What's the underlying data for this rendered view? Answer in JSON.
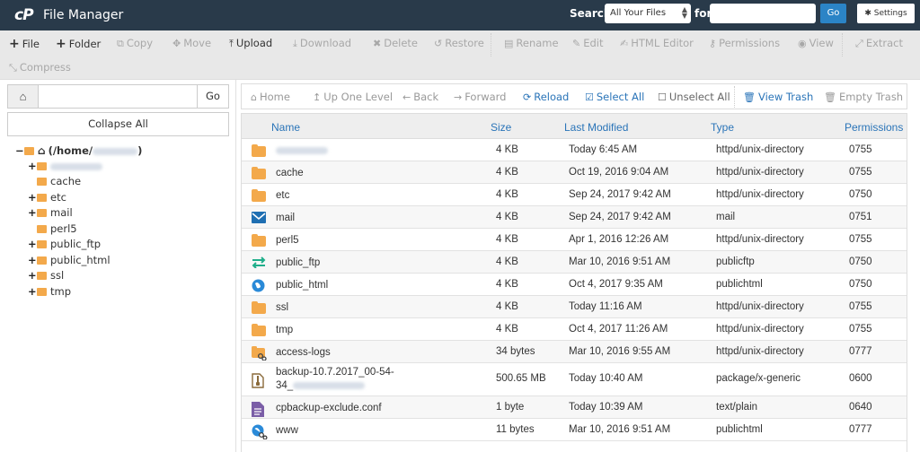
{
  "app": {
    "logo": "cP",
    "title": "File Manager"
  },
  "search": {
    "label": "Search",
    "scope_selected": "All Your Files",
    "for_label": "for",
    "query_value": "",
    "go_label": "Go"
  },
  "settings_label": "Settings",
  "toolbar": {
    "items": [
      {
        "label": "File",
        "icon": "plus-icon",
        "enabled": true
      },
      {
        "label": "Folder",
        "icon": "plus-icon",
        "enabled": true
      },
      {
        "label": "Copy",
        "icon": "copy-icon",
        "enabled": false
      },
      {
        "label": "Move",
        "icon": "move-icon",
        "enabled": false
      },
      {
        "label": "Upload",
        "icon": "upload-icon",
        "enabled": true
      },
      {
        "label": "Download",
        "icon": "download-icon",
        "enabled": false
      },
      {
        "label": "Delete",
        "icon": "delete-icon",
        "enabled": false
      },
      {
        "label": "Restore",
        "icon": "restore-icon",
        "enabled": false
      },
      {
        "label": "Rename",
        "icon": "file-icon",
        "enabled": false
      },
      {
        "label": "Edit",
        "icon": "pencil-icon",
        "enabled": false
      },
      {
        "label": "HTML Editor",
        "icon": "edit-square-icon",
        "enabled": false
      },
      {
        "label": "Permissions",
        "icon": "key-icon",
        "enabled": false
      },
      {
        "label": "View",
        "icon": "eye-icon",
        "enabled": false
      },
      {
        "label": "Extract",
        "icon": "expand-icon",
        "enabled": false
      },
      {
        "label": "Compress",
        "icon": "compress-icon",
        "enabled": false
      }
    ]
  },
  "left": {
    "path_value": "",
    "go_label": "Go",
    "collapse_label": "Collapse All",
    "tree": {
      "root_label": "(/home/",
      "items": [
        {
          "label": "",
          "blurred": true,
          "expandable": true
        },
        {
          "label": "cache",
          "expandable": false
        },
        {
          "label": "etc",
          "expandable": true
        },
        {
          "label": "mail",
          "expandable": true
        },
        {
          "label": "perl5",
          "expandable": false
        },
        {
          "label": "public_ftp",
          "expandable": true
        },
        {
          "label": "public_html",
          "expandable": true
        },
        {
          "label": "ssl",
          "expandable": true
        },
        {
          "label": "tmp",
          "expandable": true
        }
      ]
    }
  },
  "nav": {
    "home": "Home",
    "up": "Up One Level",
    "back": "Back",
    "forward": "Forward",
    "reload": "Reload",
    "select_all": "Select All",
    "unselect_all": "Unselect All",
    "view_trash": "View Trash",
    "empty_trash": "Empty Trash"
  },
  "table": {
    "headers": {
      "name": "Name",
      "size": "Size",
      "modified": "Last Modified",
      "type": "Type",
      "permissions": "Permissions"
    },
    "rows": [
      {
        "icon": "folder-icon",
        "name": "",
        "blurred": true,
        "size": "4 KB",
        "modified": "Today 6:45 AM",
        "type": "httpd/unix-directory",
        "perms": "0755"
      },
      {
        "icon": "folder-icon",
        "name": "cache",
        "size": "4 KB",
        "modified": "Oct 19, 2016 9:04 AM",
        "type": "httpd/unix-directory",
        "perms": "0755"
      },
      {
        "icon": "folder-icon",
        "name": "etc",
        "size": "4 KB",
        "modified": "Sep 24, 2017 9:42 AM",
        "type": "httpd/unix-directory",
        "perms": "0750"
      },
      {
        "icon": "envelope-icon",
        "name": "mail",
        "size": "4 KB",
        "modified": "Sep 24, 2017 9:42 AM",
        "type": "mail",
        "perms": "0751"
      },
      {
        "icon": "folder-icon",
        "name": "perl5",
        "size": "4 KB",
        "modified": "Apr 1, 2016 12:26 AM",
        "type": "httpd/unix-directory",
        "perms": "0755"
      },
      {
        "icon": "transfer-icon",
        "name": "public_ftp",
        "size": "4 KB",
        "modified": "Mar 10, 2016 9:51 AM",
        "type": "publicftp",
        "perms": "0750"
      },
      {
        "icon": "globe-icon",
        "name": "public_html",
        "size": "4 KB",
        "modified": "Oct 4, 2017 9:35 AM",
        "type": "publichtml",
        "perms": "0750"
      },
      {
        "icon": "folder-icon",
        "name": "ssl",
        "size": "4 KB",
        "modified": "Today 11:16 AM",
        "type": "httpd/unix-directory",
        "perms": "0755"
      },
      {
        "icon": "folder-icon",
        "name": "tmp",
        "size": "4 KB",
        "modified": "Oct 4, 2017 11:26 AM",
        "type": "httpd/unix-directory",
        "perms": "0755"
      },
      {
        "icon": "folder-link-icon",
        "name": "access-logs",
        "size": "34 bytes",
        "modified": "Mar 10, 2016 9:55 AM",
        "type": "httpd/unix-directory",
        "perms": "0777"
      },
      {
        "icon": "archive-icon",
        "name": "backup-10.7.2017_00-54-",
        "name_line2": "34_",
        "blurred_suffix": true,
        "size": "500.65 MB",
        "modified": "Today 10:40 AM",
        "type": "package/x-generic",
        "perms": "0600"
      },
      {
        "icon": "text-file-icon",
        "name": "cpbackup-exclude.conf",
        "size": "1 byte",
        "modified": "Today 10:39 AM",
        "type": "text/plain",
        "perms": "0640"
      },
      {
        "icon": "globe-link-icon",
        "name": "www",
        "size": "11 bytes",
        "modified": "Mar 10, 2016 9:51 AM",
        "type": "publichtml",
        "perms": "0777"
      }
    ]
  },
  "colors": {
    "topbar": "#293a4a",
    "accent_blue": "#2a74b8",
    "go_button": "#2b84c6",
    "folder": "#f3a94b",
    "toolbar_bg": "#e8e8e8"
  }
}
